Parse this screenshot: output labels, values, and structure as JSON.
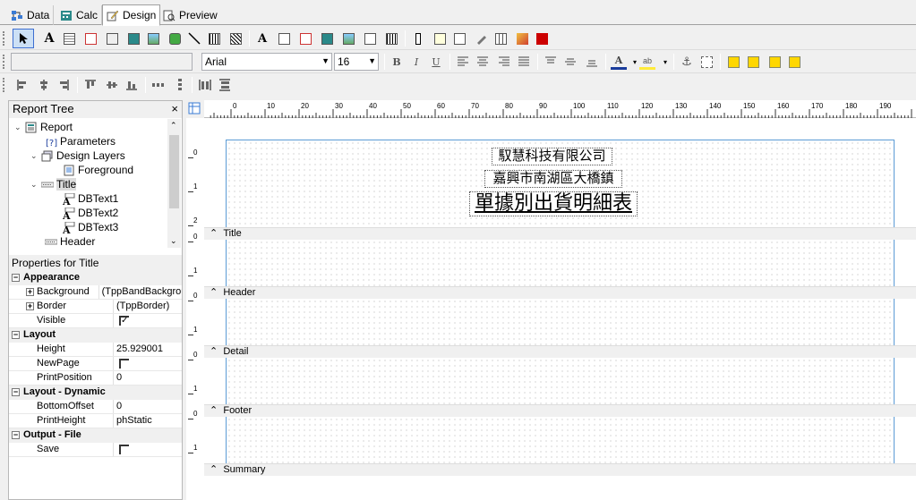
{
  "tabs": [
    {
      "label": "Data"
    },
    {
      "label": "Calc"
    },
    {
      "label": "Design"
    },
    {
      "label": "Preview"
    }
  ],
  "format_bar": {
    "font_name": "Arial",
    "font_size": "16"
  },
  "report_tree": {
    "title": "Report Tree",
    "close": "×",
    "items": [
      {
        "label": "Report"
      },
      {
        "label": "Parameters"
      },
      {
        "label": "Design Layers"
      },
      {
        "label": "Foreground"
      },
      {
        "label": "Title"
      },
      {
        "label": "DBText1"
      },
      {
        "label": "DBText2"
      },
      {
        "label": "DBText3"
      },
      {
        "label": "Header"
      }
    ]
  },
  "properties": {
    "title": "Properties for Title",
    "categories": {
      "appearance": "Appearance",
      "layout": "Layout",
      "layout_dynamic": "Layout - Dynamic",
      "output_file": "Output - File"
    },
    "rows": {
      "background": {
        "name": "Background",
        "value": "(TppBandBackground)"
      },
      "border": {
        "name": "Border",
        "value": "(TppBorder)"
      },
      "visible": {
        "name": "Visible"
      },
      "height": {
        "name": "Height",
        "value": "25.929001"
      },
      "newpage": {
        "name": "NewPage"
      },
      "printposition": {
        "name": "PrintPosition",
        "value": "0"
      },
      "bottomoffset": {
        "name": "BottomOffset",
        "value": "0"
      },
      "printheight": {
        "name": "PrintHeight",
        "value": "phStatic"
      },
      "save": {
        "name": "Save"
      }
    }
  },
  "ruler": {
    "top_labels": [
      "0",
      "10",
      "20",
      "30",
      "40",
      "50",
      "60",
      "70",
      "80",
      "90",
      "100",
      "110",
      "120",
      "130",
      "140",
      "150",
      "160",
      "170",
      "180",
      "190"
    ],
    "left_labels": [
      "0",
      "1",
      "2",
      "0",
      "1",
      "0",
      "1",
      "0",
      "1",
      "0",
      "1"
    ]
  },
  "report": {
    "dbtext1": "馭慧科技有限公司",
    "dbtext2": "嘉興市南湖區大橋鎮",
    "dbtext3": "單據別出貨明細表",
    "bands": [
      "Title",
      "Header",
      "Detail",
      "Footer",
      "Summary"
    ]
  },
  "colors": {
    "band_border": "#5b9bd5",
    "selection": "#3d6fd1"
  }
}
